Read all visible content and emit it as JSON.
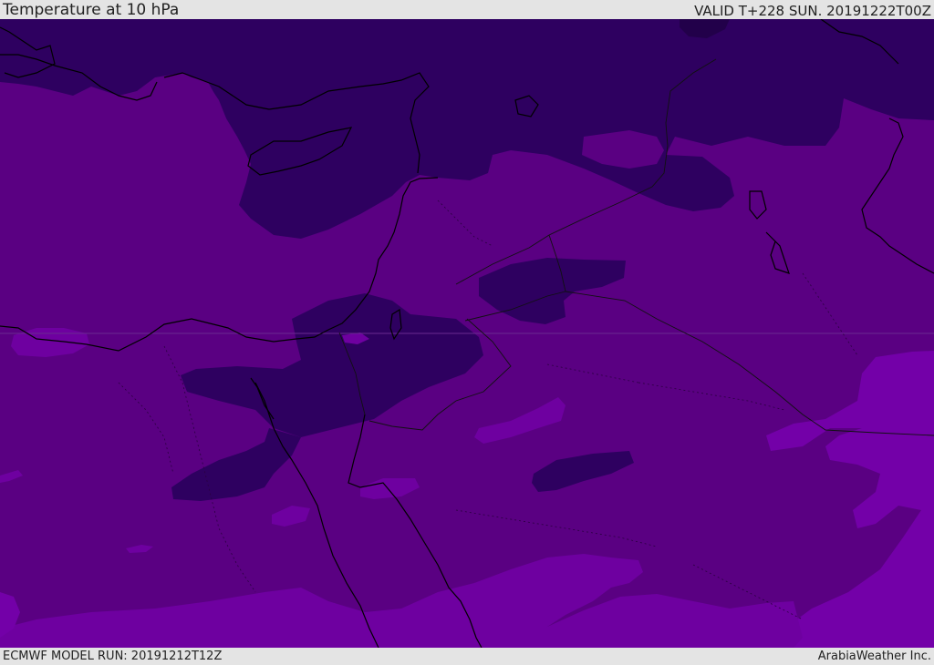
{
  "header": {
    "title": "Temperature at 10 hPa",
    "valid_time": "VALID T+228 SUN. 20191222T00Z"
  },
  "footer": {
    "model_run": "ECMWF MODEL RUN: 20191212T12Z",
    "credit": "ArabiaWeather Inc."
  },
  "map": {
    "colors": {
      "base": "#5a0082",
      "cold": "#2e0060",
      "coldest": "#22004a",
      "warm": "#6e00a0",
      "warmer": "#7300a8",
      "coastline": "#000000",
      "border": "#111111"
    },
    "legend_visible": false
  }
}
